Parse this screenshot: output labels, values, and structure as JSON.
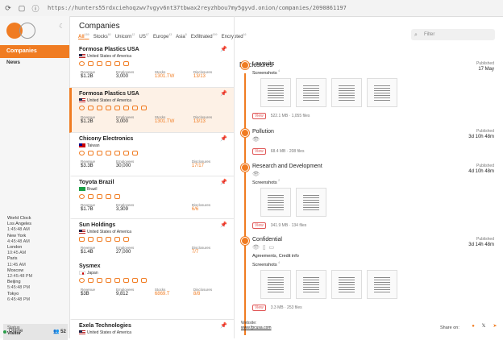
{
  "browser": {
    "url": "https://hunters55rdxciehoqzwv7vgyv6nt37tbwax2reyzhbou7my5gyvd.onion/companies/2090861197",
    "reload_icon": "reload-icon",
    "tab_icon": "tab-icon"
  },
  "sidebar": {
    "nav_companies": "Companies",
    "nav_news": "News",
    "world_clock": {
      "title": "World Clock",
      "entries": [
        {
          "city": "Los Angeles",
          "time": "1:45:48 AM"
        },
        {
          "city": "New York",
          "time": "4:45:48 AM"
        },
        {
          "city": "London",
          "time": "10:45 AM"
        },
        {
          "city": "Paris",
          "time": "11:45 AM"
        },
        {
          "city": "Moscow",
          "time": "12:45:48 PM"
        },
        {
          "city": "Beijing",
          "time": "5:45:48 PM"
        },
        {
          "city": "Tokyo",
          "time": "6:45:48 PM"
        }
      ]
    },
    "visitor_label": "Status",
    "visitor_value": "Visitor",
    "online_label": "Online",
    "online_count": "52"
  },
  "list": {
    "title": "Companies",
    "filters": [
      {
        "label": "All",
        "count": "159",
        "active": true
      },
      {
        "label": "Stocks",
        "count": "60"
      },
      {
        "label": "Unicorn",
        "count": "12"
      },
      {
        "label": "US",
        "count": "67"
      },
      {
        "label": "Europe",
        "count": "43"
      },
      {
        "label": "Asia",
        "count": "8"
      },
      {
        "label": "Exfiltrated",
        "count": "159"
      },
      {
        "label": "Encrypted",
        "count": "16"
      }
    ],
    "companies": [
      {
        "name": "Formosa Plastics USA",
        "country": "United States of America",
        "flag": "us",
        "selected": false,
        "stats": [
          [
            "Revenue",
            "$1.2B"
          ],
          [
            "Employees",
            "3,000"
          ],
          [
            "Stocks",
            "1301.TW"
          ],
          [
            "Disclosures",
            "13/13"
          ]
        ]
      },
      {
        "name": "Formosa Plastics USA",
        "country": "United States of America",
        "flag": "us",
        "selected": true,
        "stats": [
          [
            "Revenue",
            "$1.2B"
          ],
          [
            "Employees",
            "3,000"
          ],
          [
            "Stocks",
            "1301.TW"
          ],
          [
            "Disclosures",
            "13/13"
          ]
        ]
      },
      {
        "name": "Chicony Electronics",
        "country": "Taiwan",
        "flag": "tw",
        "selected": false,
        "stats": [
          [
            "Revenue",
            "$3.3B"
          ],
          [
            "Employees",
            "30,000"
          ],
          [
            "Disclosures",
            "17/17"
          ]
        ]
      },
      {
        "name": "Toyota Brazil",
        "country": "Brazil",
        "flag": "br",
        "selected": false,
        "stats": [
          [
            "Revenue",
            "$1.7B"
          ],
          [
            "Employees",
            "3,309"
          ],
          [
            "Disclosures",
            "6/6"
          ]
        ]
      },
      {
        "name": "Sun Holdings",
        "country": "United States of America",
        "flag": "us",
        "selected": false,
        "stats": [
          [
            "Revenue",
            "$1.4B"
          ],
          [
            "Employees",
            "27,000"
          ],
          [
            "Disclosures",
            "7/7"
          ]
        ]
      },
      {
        "name": "Sysmex",
        "country": "Japan",
        "flag": "jp",
        "selected": false,
        "stats": [
          [
            "Revenue",
            "$3B"
          ],
          [
            "Employees",
            "9,812"
          ],
          [
            "Stocks",
            "6869.T"
          ],
          [
            "Disclosures",
            "8/8"
          ]
        ]
      },
      {
        "name": "Exela Technologies",
        "country": "United States of America",
        "flag": "us",
        "selected": false,
        "stats": []
      }
    ]
  },
  "detail": {
    "search_placeholder": "Filter",
    "title": "Disclosures",
    "published_label": "Published",
    "view_label": "View",
    "events": [
      {
        "title": "Lawsuits",
        "date": "17 May",
        "screenshots_label": "Screenshots",
        "shots_count": "4",
        "size": "522.1 MB",
        "files": "1,055 files"
      },
      {
        "title": "Pollution",
        "date": "3d 10h 48m",
        "size": "68.4 MB",
        "files": "208 files"
      },
      {
        "title": "Research and Development",
        "date": "4d 10h 48m",
        "screenshots_label": "Screenshots",
        "shots_count": "2",
        "size": "341.9 MB",
        "files": "134 files"
      },
      {
        "title": "Confidential",
        "date": "3d 14h 48m",
        "agreements": "Agreements, Credit info",
        "screenshots_label": "Screenshots",
        "shots_count": "4",
        "size": "3.3 MB",
        "files": "253 files"
      }
    ],
    "website_label": "Website:",
    "website": "www.fpcusa.com",
    "share_label": "Share on:"
  }
}
